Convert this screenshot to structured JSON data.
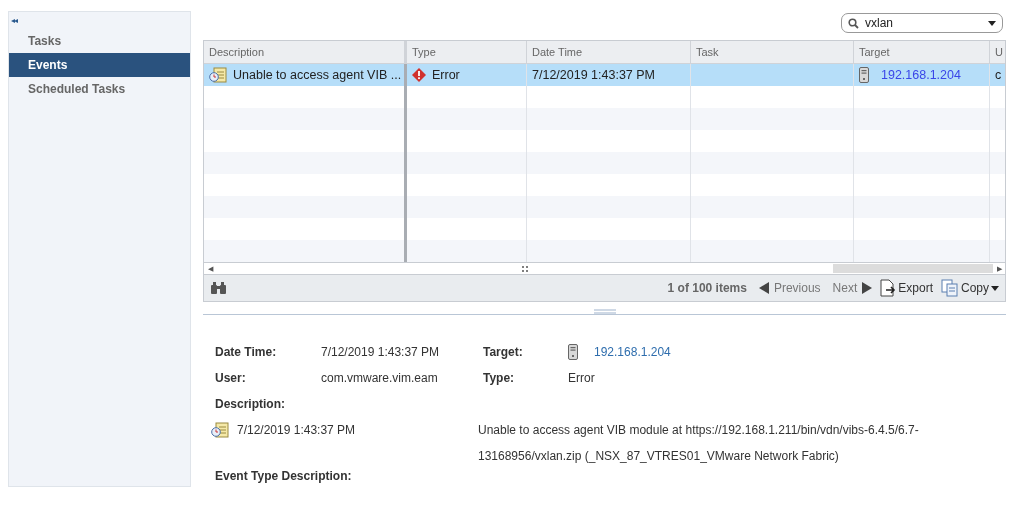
{
  "sidebar": {
    "collapse": "◂◂",
    "items": [
      {
        "label": "Tasks",
        "selected": false
      },
      {
        "label": "Events",
        "selected": true
      },
      {
        "label": "Scheduled Tasks",
        "selected": false
      }
    ]
  },
  "search": {
    "value": "vxlan"
  },
  "grid": {
    "columns": [
      "Description",
      "Type",
      "Date Time",
      "Task",
      "Target",
      "U"
    ],
    "scroll_left": "◀",
    "scroll_right": "▶",
    "rows": [
      {
        "selected": true,
        "description": "Unable to access agent VIB ...",
        "type": "Error",
        "date_time": "7/12/2019 1:43:37 PM",
        "target": "192.168.1.204",
        "column_6": "c"
      }
    ]
  },
  "pager": {
    "count": "1 of 100 items",
    "previous": "Previous",
    "next": "Next",
    "export": "Export",
    "copy": "Copy"
  },
  "details": {
    "fields": [
      {
        "label": "Date Time:",
        "value": "7/12/2019 1:43:37 PM",
        "kind": "text"
      },
      {
        "label": "Target:",
        "value": "192.168.1.204",
        "kind": "link"
      },
      {
        "label": "User:",
        "value": "com.vmware.vim.eam",
        "kind": "text"
      },
      {
        "label": "Type:",
        "value": "Error",
        "kind": "text"
      }
    ],
    "description_label": "Description:",
    "entry": {
      "time": "7/12/2019 1:43:37 PM",
      "message": "Unable to access agent VIB module at https://192.168.1.211/bin/vdn/vibs-6.4.5/6.7-13168956/vxlan.zip (_NSX_87_VTRES01_VMware Network Fabric)"
    },
    "event_type_label": "Event Type Description:"
  }
}
